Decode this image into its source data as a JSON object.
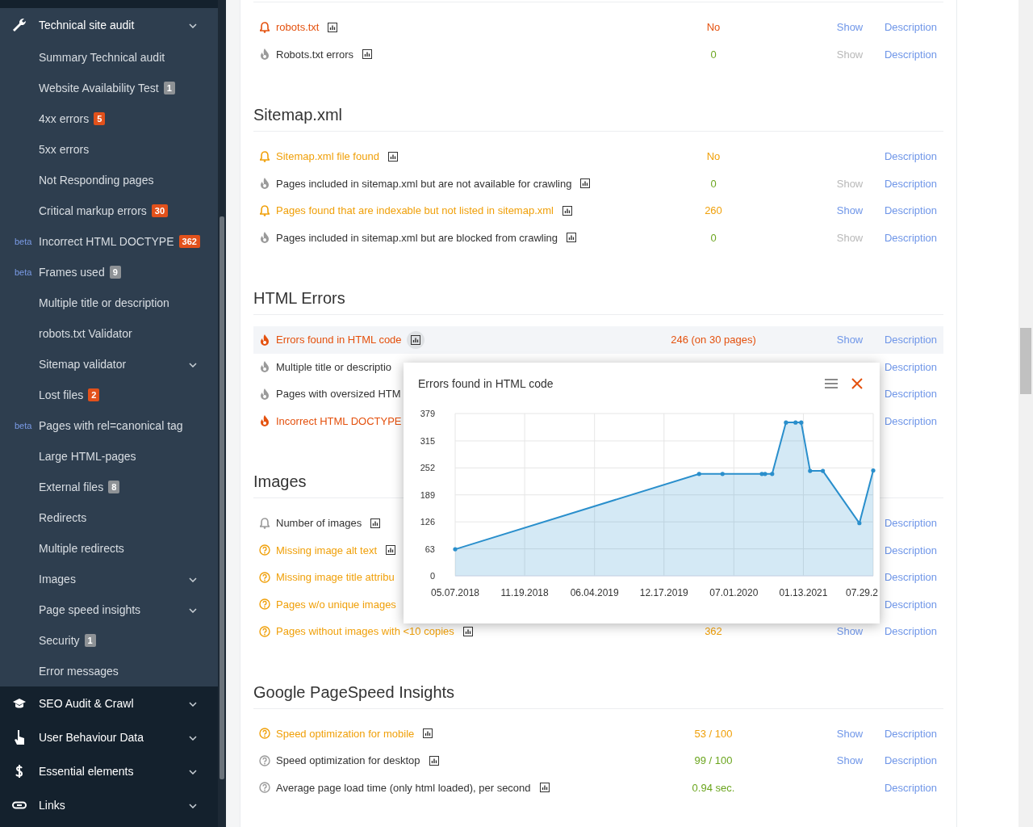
{
  "sidebar": {
    "groups": [
      {
        "label": "Technical site audit",
        "kind": "wrench",
        "expanded": true,
        "children": [
          {
            "label": "Summary Technical audit",
            "beta": false,
            "submenu": false
          },
          {
            "label": "Website Availability Test",
            "badge": "1",
            "color": "#8e9296",
            "beta": false,
            "submenu": false
          },
          {
            "label": "4xx errors",
            "badge": "5",
            "color": "#e2511b",
            "beta": false,
            "submenu": false
          },
          {
            "label": "5xx errors",
            "beta": false,
            "submenu": false
          },
          {
            "label": "Not Responding pages",
            "beta": false,
            "submenu": false
          },
          {
            "label": "Critical markup errors",
            "badge": "30",
            "color": "#e2511b",
            "beta": false,
            "submenu": false
          },
          {
            "label": "Incorrect HTML DOCTYPE",
            "badge": "362",
            "color": "#e2511b",
            "beta": true,
            "beta_label": "beta",
            "submenu": false
          },
          {
            "label": "Frames used",
            "badge": "9",
            "color": "#8e9296",
            "beta": true,
            "beta_label": "beta",
            "submenu": false
          },
          {
            "label": "Multiple title or description",
            "beta": false,
            "submenu": false
          },
          {
            "label": "robots.txt Validator",
            "beta": false,
            "submenu": false
          },
          {
            "label": "Sitemap validator",
            "beta": false,
            "submenu": true
          },
          {
            "label": "Lost files",
            "badge": "2",
            "color": "#e2511b",
            "beta": false,
            "submenu": false
          },
          {
            "label": "Pages with rel=canonical tag",
            "beta": true,
            "beta_label": "beta",
            "submenu": false
          },
          {
            "label": "Large HTML-pages",
            "beta": false,
            "submenu": false
          },
          {
            "label": "External files",
            "badge": "8",
            "color": "#8e9296",
            "beta": false,
            "submenu": false
          },
          {
            "label": "Redirects",
            "beta": false,
            "submenu": false
          },
          {
            "label": "Multiple redirects",
            "beta": false,
            "submenu": false
          },
          {
            "label": "Images",
            "beta": false,
            "submenu": true
          },
          {
            "label": "Page speed insights",
            "beta": false,
            "submenu": true
          },
          {
            "label": "Security",
            "badge": "1",
            "color": "#8e9296",
            "beta": false,
            "submenu": false
          },
          {
            "label": "Error messages",
            "beta": false,
            "submenu": false
          }
        ]
      },
      {
        "label": "SEO Audit & Crawl",
        "kind": "cap",
        "expanded": false
      },
      {
        "label": "User Behaviour Data",
        "kind": "hand",
        "expanded": false
      },
      {
        "label": "Essential elements",
        "kind": "dollar",
        "expanded": false
      },
      {
        "label": "Links",
        "kind": "link",
        "expanded": false
      }
    ]
  },
  "sections": [
    {
      "rows": [
        {
          "kind": "bell",
          "color": "#e4510e",
          "label": "robots.txt",
          "chart_icon": true,
          "value": {
            "text": "No",
            "color": "#e4510e"
          },
          "show": "Show",
          "show_enabled": true,
          "description": "Description",
          "highlighted": false
        },
        {
          "kind": "fire",
          "color": "#333333",
          "label": "Robots.txt errors",
          "chart_icon": true,
          "value": {
            "text": "0",
            "color": "#6ba51e"
          },
          "show": "Show",
          "show_enabled": false,
          "description": "Description",
          "highlighted": false
        }
      ]
    },
    {
      "heading": "Sitemap.xml",
      "rows": [
        {
          "kind": "bell",
          "color": "#f0a00a",
          "label": "Sitemap.xml file found",
          "chart_icon": true,
          "value": {
            "text": "No",
            "color": "#f0a00a"
          },
          "description": "Description",
          "highlighted": false
        },
        {
          "kind": "fire",
          "color": "#333333",
          "label": "Pages included in sitemap.xml but are not available for crawling",
          "chart_icon": true,
          "value": {
            "text": "0",
            "color": "#6ba51e"
          },
          "show": "Show",
          "show_enabled": false,
          "description": "Description",
          "highlighted": false
        },
        {
          "kind": "bell",
          "color": "#f0a00a",
          "label": "Pages found that are indexable but not listed in sitemap.xml",
          "chart_icon": true,
          "value": {
            "text": "260",
            "color": "#f0a00a"
          },
          "show": "Show",
          "show_enabled": true,
          "description": "Description",
          "highlighted": false
        },
        {
          "kind": "fire",
          "color": "#333333",
          "label": "Pages included in sitemap.xml but are blocked from crawling",
          "chart_icon": true,
          "value": {
            "text": "0",
            "color": "#6ba51e"
          },
          "show": "Show",
          "show_enabled": false,
          "description": "Description",
          "highlighted": false
        }
      ]
    },
    {
      "heading": "HTML Errors",
      "rows": [
        {
          "kind": "fire",
          "color": "#e4510e",
          "label": "Errors found in HTML code",
          "chart_icon": true,
          "value": {
            "text": "246 (on 30 pages)",
            "color": "#e4510e"
          },
          "show": "Show",
          "show_enabled": true,
          "description": "Description",
          "highlighted": true
        },
        {
          "kind": "fire",
          "color": "#333333",
          "label": "Multiple title or descriptio",
          "chart_icon": false,
          "description": "Description",
          "highlighted": false
        },
        {
          "kind": "fire",
          "color": "#333333",
          "label": "Pages with oversized HTM",
          "chart_icon": false,
          "description": "Description",
          "highlighted": false
        },
        {
          "kind": "fire",
          "color": "#e4510e",
          "label": "Incorrect HTML DOCTYPE",
          "chart_icon": false,
          "description": "Description",
          "highlighted": false
        }
      ]
    },
    {
      "heading": "Images",
      "rows": [
        {
          "kind": "bell",
          "color": "#333333",
          "label": "Number of images",
          "chart_icon": true,
          "description": "Description",
          "highlighted": false
        },
        {
          "kind": "question",
          "color": "#f0a00a",
          "label": "Missing image alt text",
          "chart_icon": true,
          "description": "Description",
          "highlighted": false
        },
        {
          "kind": "question",
          "color": "#f0a00a",
          "label": "Missing image title attribu",
          "chart_icon": false,
          "description": "Description",
          "highlighted": false
        },
        {
          "kind": "question",
          "color": "#f0a00a",
          "label": "Pages w/o unique images",
          "chart_icon": false,
          "description": "Description",
          "highlighted": false
        },
        {
          "kind": "question",
          "color": "#f0a00a",
          "label": "Pages without images with <10 copies",
          "chart_icon": true,
          "value": {
            "text": "362",
            "color": "#f0a00a"
          },
          "show": "Show",
          "show_enabled": true,
          "description": "Description",
          "highlighted": false
        }
      ]
    },
    {
      "heading": "Google PageSpeed Insights",
      "rows": [
        {
          "kind": "question",
          "color": "#f0a00a",
          "label": "Speed optimization for mobile",
          "chart_icon": true,
          "value": {
            "text": "53 / 100",
            "color": "#f0a00a"
          },
          "show": "Show",
          "show_enabled": true,
          "description": "Description",
          "highlighted": false
        },
        {
          "kind": "question",
          "color": "#333333",
          "label": "Speed optimization for desktop",
          "chart_icon": true,
          "value": {
            "text": "99 / 100",
            "color": "#6ba51e"
          },
          "show": "Show",
          "show_enabled": true,
          "description": "Description",
          "highlighted": false
        },
        {
          "kind": "question",
          "color": "#333333",
          "label": "Average page load time (only html loaded), per second",
          "chart_icon": true,
          "value": {
            "text": "0.94 sec.",
            "color": "#6ba51e"
          },
          "description": "Description",
          "highlighted": false
        }
      ]
    }
  ],
  "popup": {
    "title": "Errors found in HTML code",
    "chart_data": {
      "type": "area",
      "grid": true,
      "x": [
        "2018-05-07",
        "2020-03-25",
        "2020-05-30",
        "2020-09-18",
        "2020-09-27",
        "2020-10-17",
        "2020-11-25",
        "2020-12-22",
        "2021-01-07",
        "2021-02-01",
        "2021-03-09",
        "2021-06-20",
        "2021-07-29"
      ],
      "series": [
        {
          "color": "#2a8fcc",
          "values": [
            62,
            238,
            238,
            238,
            238,
            238,
            358,
            358,
            358,
            245,
            245,
            123,
            246
          ]
        }
      ],
      "xlim": [
        "2018-05-07",
        "2021-07-29"
      ],
      "ylim": [
        0,
        379
      ],
      "xticks": [
        {
          "value": "2018-05-07",
          "label": "05.07.2018"
        },
        {
          "value": "2018-11-19",
          "label": "11.19.2018"
        },
        {
          "value": "2019-06-04",
          "label": "06.04.2019"
        },
        {
          "value": "2019-12-17",
          "label": "12.17.2019"
        },
        {
          "value": "2020-07-01",
          "label": "07.01.2020"
        },
        {
          "value": "2021-01-13",
          "label": "01.13.2021"
        },
        {
          "value": "2021-07-29",
          "label": "07.29.2"
        }
      ],
      "yticks": [
        0,
        63,
        126,
        189,
        252,
        315,
        379
      ]
    }
  }
}
